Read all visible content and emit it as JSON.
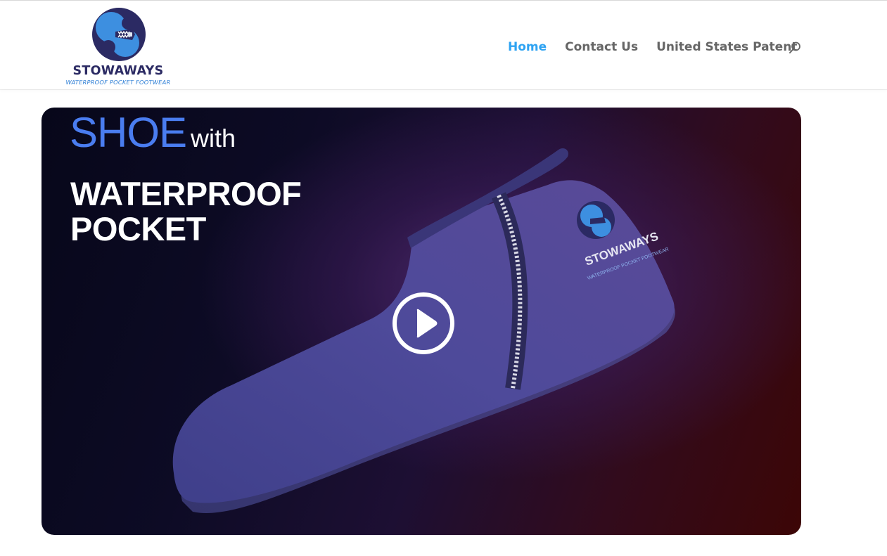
{
  "brand": {
    "name": "STOWAWAYS",
    "tagline": "WATERPROOF POCKET FOOTWEAR"
  },
  "nav": {
    "items": [
      {
        "label": "Home",
        "active": true
      },
      {
        "label": "Contact Us",
        "active": false
      },
      {
        "label": "United States Patent",
        "active": false
      }
    ],
    "search_icon": "search-icon"
  },
  "video": {
    "headline_big": "SHOE",
    "headline_small": "with",
    "headline_main": "WATERPROOF POCKET",
    "shoe_logo_name": "STOWAWAYS",
    "shoe_logo_tagline": "WATERPROOF POCKET FOOTWEAR",
    "play_icon": "play-icon"
  },
  "colors": {
    "nav_active": "#2ea3f2",
    "nav_default": "#666666",
    "brand_navy": "#2b2a63",
    "brand_blue": "#2e7fd6",
    "headline_blue": "#4a7df0"
  }
}
